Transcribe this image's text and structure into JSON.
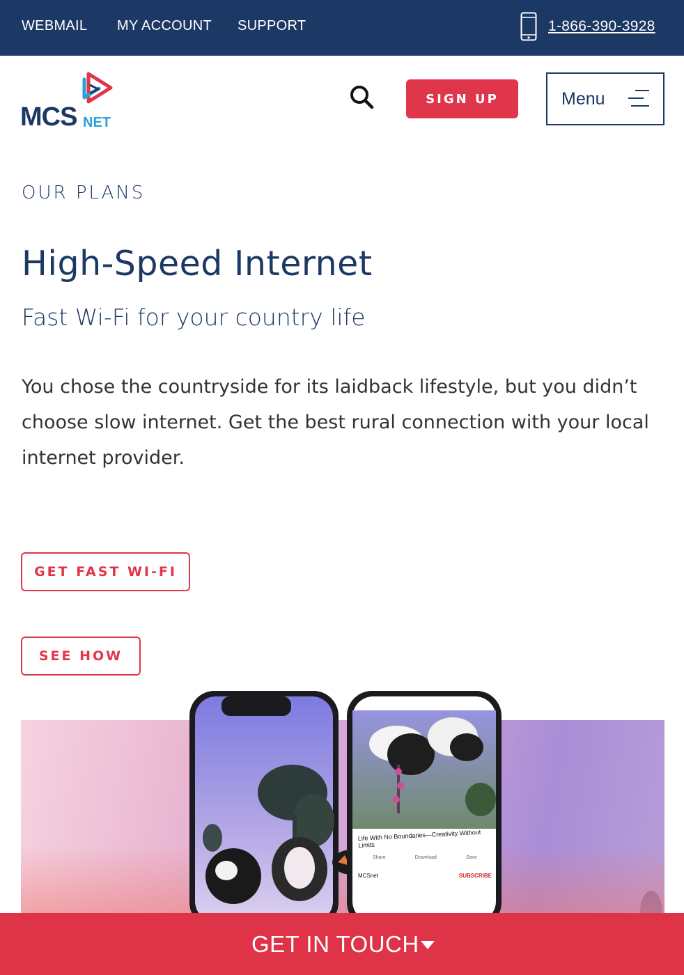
{
  "topbar": {
    "links": [
      "WEBMAIL",
      "MY ACCOUNT",
      "SUPPORT"
    ],
    "phone": "1-866-390-3928"
  },
  "header": {
    "logo_text": "MCS NET",
    "signup_label": "SIGN UP",
    "menu_label": "Menu"
  },
  "content": {
    "eyebrow": "OUR PLANS",
    "title": "High-Speed Internet",
    "subtitle": "Fast Wi-Fi for your country life",
    "body": "You chose the countryside for its laidback lifestyle, but you didn’t choose slow internet. Get the best rural connection with your local internet provider.",
    "cta_primary": "GET FAST WI-FI",
    "cta_secondary": "SEE HOW"
  },
  "hero": {
    "video_title": "Life With No Boundaries—Creativity Without Limits",
    "actions": [
      "Share",
      "Download",
      "Save"
    ],
    "channel": "MCSnet",
    "subscribe": "SUBSCRIBE"
  },
  "footer_bar": {
    "label": "GET IN TOUCH"
  },
  "colors": {
    "navy": "#1c3864",
    "accent_red": "#e0364b"
  }
}
